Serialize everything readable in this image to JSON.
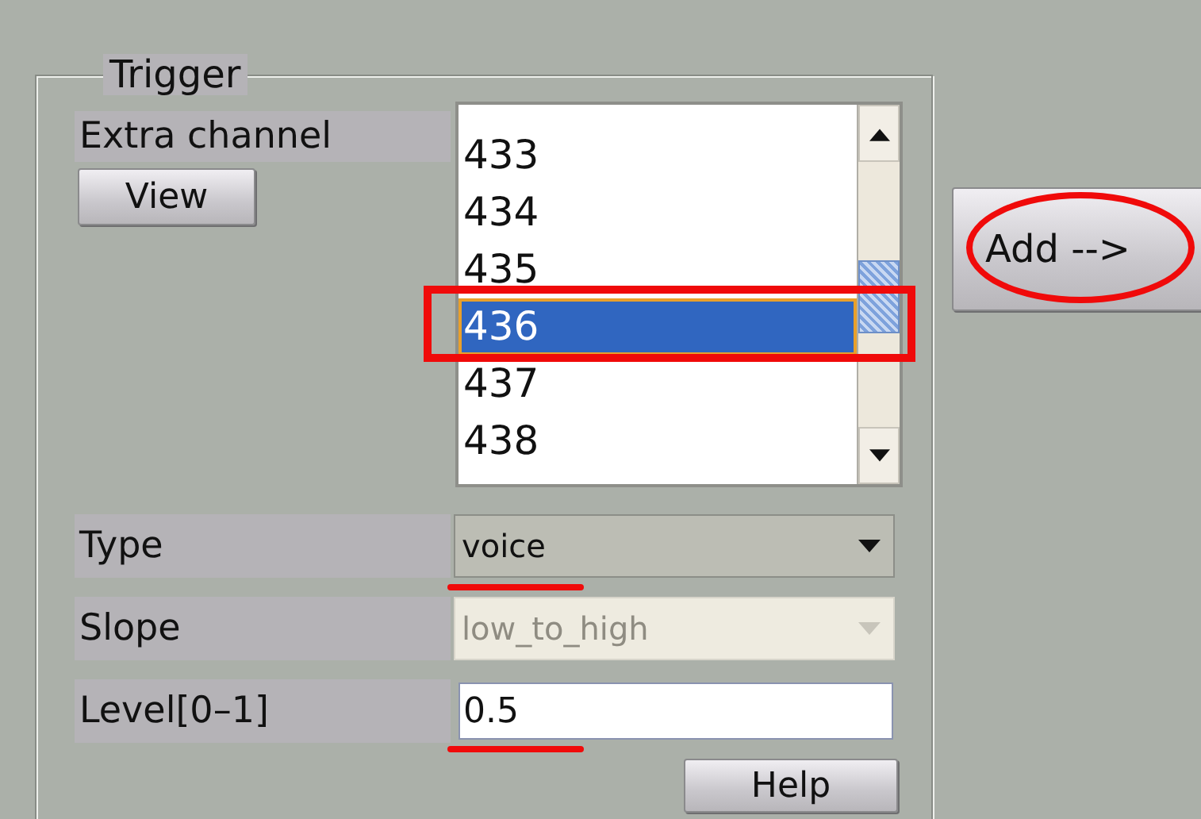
{
  "group": {
    "title": "Trigger"
  },
  "extra_channel": {
    "label": "Extra channel",
    "view_button": "View",
    "items": [
      {
        "label": "433",
        "selected": false,
        "highlighted": false
      },
      {
        "label": "434",
        "selected": false,
        "highlighted": false
      },
      {
        "label": "435",
        "selected": false,
        "highlighted": false
      },
      {
        "label": "436",
        "selected": true,
        "highlighted": true
      },
      {
        "label": "437",
        "selected": false,
        "highlighted": false
      },
      {
        "label": "438",
        "selected": false,
        "highlighted": false
      }
    ]
  },
  "add_button": {
    "label": "Add -->",
    "highlighted": true
  },
  "fields": [
    {
      "kind": "combo",
      "label": "Type",
      "value": "voice",
      "disabled": false,
      "underlined": true
    },
    {
      "kind": "combo",
      "label": "Slope",
      "value": "low_to_high",
      "disabled": true,
      "underlined": false
    },
    {
      "kind": "input",
      "label": "Level[0–1]",
      "value": "0.5",
      "disabled": false,
      "underlined": true
    }
  ],
  "help_button": "Help"
}
